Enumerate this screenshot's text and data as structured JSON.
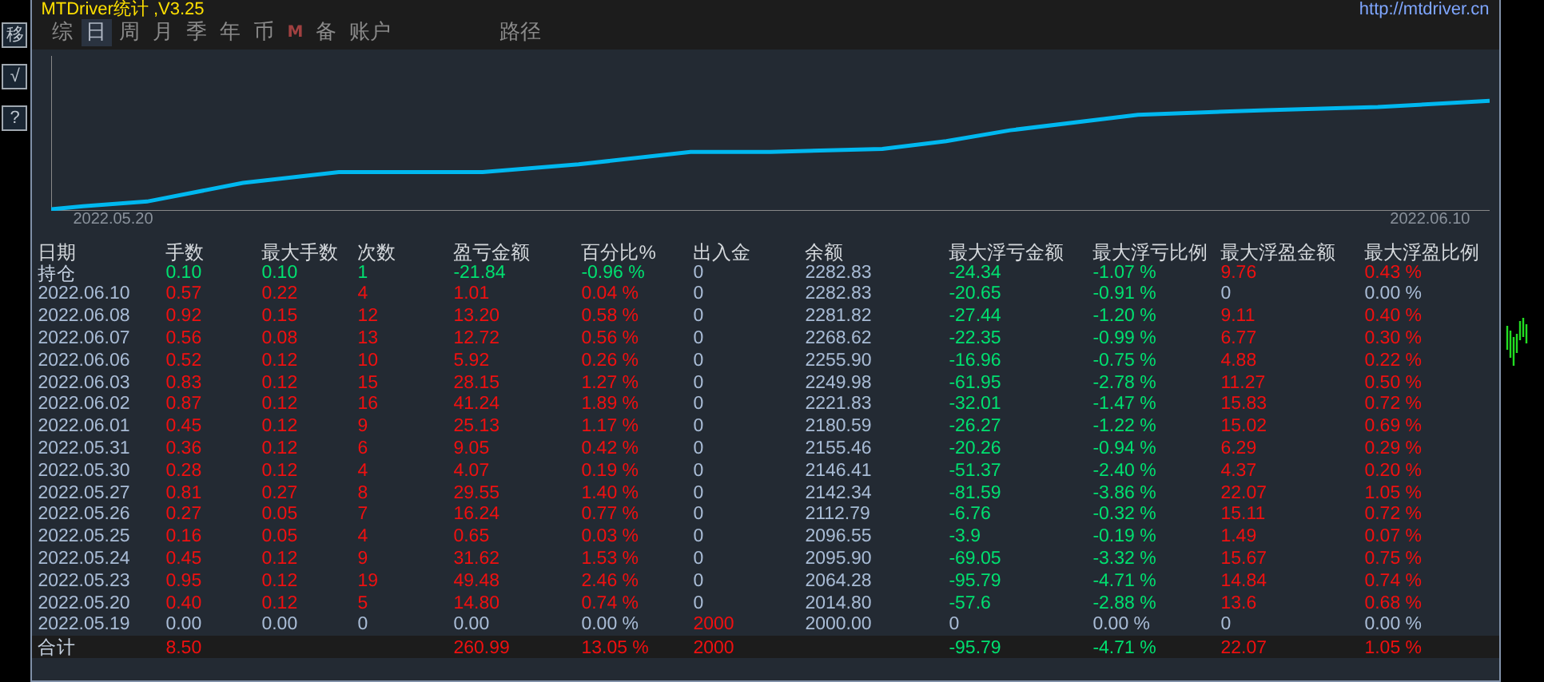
{
  "title": "MTDriver统计 ,V3.25",
  "url": "http://mtdriver.cn",
  "toolbar": [
    "移",
    "√",
    "?"
  ],
  "tabs": [
    {
      "label": "综",
      "selected": false,
      "kind": "text"
    },
    {
      "label": "日",
      "selected": true,
      "kind": "text"
    },
    {
      "label": "周",
      "selected": false,
      "kind": "text"
    },
    {
      "label": "月",
      "selected": false,
      "kind": "text"
    },
    {
      "label": "季",
      "selected": false,
      "kind": "text"
    },
    {
      "label": "年",
      "selected": false,
      "kind": "text"
    },
    {
      "label": "币",
      "selected": false,
      "kind": "text"
    },
    {
      "label": "M",
      "selected": false,
      "kind": "mark"
    },
    {
      "label": "备",
      "selected": false,
      "kind": "text"
    },
    {
      "label": "账户",
      "selected": false,
      "kind": "text"
    },
    {
      "label": "路径",
      "selected": false,
      "kind": "far"
    }
  ],
  "chart": {
    "start_label": "2022.05.20",
    "end_label": "2022.06.10"
  },
  "table": {
    "columns": [
      "日期",
      "手数",
      "最大手数",
      "次数",
      "盈亏金额",
      "百分比%",
      "出入金",
      "余额",
      "最大浮亏金额",
      "最大浮亏比例",
      "最大浮盈金额",
      "最大浮盈比例"
    ],
    "rows": [
      [
        {
          "text": "持仓",
          "color": "#c8d4e4"
        },
        {
          "text": "0.10",
          "color": "#00e070"
        },
        {
          "text": "0.10",
          "color": "#00e070"
        },
        {
          "text": "1",
          "color": "#00e070"
        },
        {
          "text": "-21.84",
          "color": "#00e070"
        },
        {
          "text": "-0.96 %",
          "color": "#00e070"
        },
        {
          "text": "0",
          "color": "#a9bcd6"
        },
        {
          "text": "2282.83",
          "color": "#a9bcd6"
        },
        {
          "text": "-24.34",
          "color": "#00e070"
        },
        {
          "text": "-1.07 %",
          "color": "#00e070"
        },
        {
          "text": "9.76",
          "color": "#f01010"
        },
        {
          "text": "0.43 %",
          "color": "#f01010"
        }
      ],
      [
        {
          "text": "2022.06.10",
          "color": "#a9bcd6"
        },
        {
          "text": "0.57",
          "color": "#f01010"
        },
        {
          "text": "0.22",
          "color": "#f01010"
        },
        {
          "text": "4",
          "color": "#f01010"
        },
        {
          "text": "1.01",
          "color": "#f01010"
        },
        {
          "text": "0.04 %",
          "color": "#f01010"
        },
        {
          "text": "0",
          "color": "#a9bcd6"
        },
        {
          "text": "2282.83",
          "color": "#a9bcd6"
        },
        {
          "text": "-20.65",
          "color": "#00e070"
        },
        {
          "text": "-0.91 %",
          "color": "#00e070"
        },
        {
          "text": "0",
          "color": "#a9bcd6"
        },
        {
          "text": "0.00 %",
          "color": "#a9bcd6"
        }
      ],
      [
        {
          "text": "2022.06.08",
          "color": "#a9bcd6"
        },
        {
          "text": "0.92",
          "color": "#f01010"
        },
        {
          "text": "0.15",
          "color": "#f01010"
        },
        {
          "text": "12",
          "color": "#f01010"
        },
        {
          "text": "13.20",
          "color": "#f01010"
        },
        {
          "text": "0.58 %",
          "color": "#f01010"
        },
        {
          "text": "0",
          "color": "#a9bcd6"
        },
        {
          "text": "2281.82",
          "color": "#a9bcd6"
        },
        {
          "text": "-27.44",
          "color": "#00e070"
        },
        {
          "text": "-1.20 %",
          "color": "#00e070"
        },
        {
          "text": "9.11",
          "color": "#f01010"
        },
        {
          "text": "0.40 %",
          "color": "#f01010"
        }
      ],
      [
        {
          "text": "2022.06.07",
          "color": "#a9bcd6"
        },
        {
          "text": "0.56",
          "color": "#f01010"
        },
        {
          "text": "0.08",
          "color": "#f01010"
        },
        {
          "text": "13",
          "color": "#f01010"
        },
        {
          "text": "12.72",
          "color": "#f01010"
        },
        {
          "text": "0.56 %",
          "color": "#f01010"
        },
        {
          "text": "0",
          "color": "#a9bcd6"
        },
        {
          "text": "2268.62",
          "color": "#a9bcd6"
        },
        {
          "text": "-22.35",
          "color": "#00e070"
        },
        {
          "text": "-0.99 %",
          "color": "#00e070"
        },
        {
          "text": "6.77",
          "color": "#f01010"
        },
        {
          "text": "0.30 %",
          "color": "#f01010"
        }
      ],
      [
        {
          "text": "2022.06.06",
          "color": "#a9bcd6"
        },
        {
          "text": "0.52",
          "color": "#f01010"
        },
        {
          "text": "0.12",
          "color": "#f01010"
        },
        {
          "text": "10",
          "color": "#f01010"
        },
        {
          "text": "5.92",
          "color": "#f01010"
        },
        {
          "text": "0.26 %",
          "color": "#f01010"
        },
        {
          "text": "0",
          "color": "#a9bcd6"
        },
        {
          "text": "2255.90",
          "color": "#a9bcd6"
        },
        {
          "text": "-16.96",
          "color": "#00e070"
        },
        {
          "text": "-0.75 %",
          "color": "#00e070"
        },
        {
          "text": "4.88",
          "color": "#f01010"
        },
        {
          "text": "0.22 %",
          "color": "#f01010"
        }
      ],
      [
        {
          "text": "2022.06.03",
          "color": "#a9bcd6"
        },
        {
          "text": "0.83",
          "color": "#f01010"
        },
        {
          "text": "0.12",
          "color": "#f01010"
        },
        {
          "text": "15",
          "color": "#f01010"
        },
        {
          "text": "28.15",
          "color": "#f01010"
        },
        {
          "text": "1.27 %",
          "color": "#f01010"
        },
        {
          "text": "0",
          "color": "#a9bcd6"
        },
        {
          "text": "2249.98",
          "color": "#a9bcd6"
        },
        {
          "text": "-61.95",
          "color": "#00e070"
        },
        {
          "text": "-2.78 %",
          "color": "#00e070"
        },
        {
          "text": "11.27",
          "color": "#f01010"
        },
        {
          "text": "0.50 %",
          "color": "#f01010"
        }
      ],
      [
        {
          "text": "2022.06.02",
          "color": "#a9bcd6"
        },
        {
          "text": "0.87",
          "color": "#f01010"
        },
        {
          "text": "0.12",
          "color": "#f01010"
        },
        {
          "text": "16",
          "color": "#f01010"
        },
        {
          "text": "41.24",
          "color": "#f01010"
        },
        {
          "text": "1.89 %",
          "color": "#f01010"
        },
        {
          "text": "0",
          "color": "#a9bcd6"
        },
        {
          "text": "2221.83",
          "color": "#a9bcd6"
        },
        {
          "text": "-32.01",
          "color": "#00e070"
        },
        {
          "text": "-1.47 %",
          "color": "#00e070"
        },
        {
          "text": "15.83",
          "color": "#f01010"
        },
        {
          "text": "0.72 %",
          "color": "#f01010"
        }
      ],
      [
        {
          "text": "2022.06.01",
          "color": "#a9bcd6"
        },
        {
          "text": "0.45",
          "color": "#f01010"
        },
        {
          "text": "0.12",
          "color": "#f01010"
        },
        {
          "text": "9",
          "color": "#f01010"
        },
        {
          "text": "25.13",
          "color": "#f01010"
        },
        {
          "text": "1.17 %",
          "color": "#f01010"
        },
        {
          "text": "0",
          "color": "#a9bcd6"
        },
        {
          "text": "2180.59",
          "color": "#a9bcd6"
        },
        {
          "text": "-26.27",
          "color": "#00e070"
        },
        {
          "text": "-1.22 %",
          "color": "#00e070"
        },
        {
          "text": "15.02",
          "color": "#f01010"
        },
        {
          "text": "0.69 %",
          "color": "#f01010"
        }
      ],
      [
        {
          "text": "2022.05.31",
          "color": "#a9bcd6"
        },
        {
          "text": "0.36",
          "color": "#f01010"
        },
        {
          "text": "0.12",
          "color": "#f01010"
        },
        {
          "text": "6",
          "color": "#f01010"
        },
        {
          "text": "9.05",
          "color": "#f01010"
        },
        {
          "text": "0.42 %",
          "color": "#f01010"
        },
        {
          "text": "0",
          "color": "#a9bcd6"
        },
        {
          "text": "2155.46",
          "color": "#a9bcd6"
        },
        {
          "text": "-20.26",
          "color": "#00e070"
        },
        {
          "text": "-0.94 %",
          "color": "#00e070"
        },
        {
          "text": "6.29",
          "color": "#f01010"
        },
        {
          "text": "0.29 %",
          "color": "#f01010"
        }
      ],
      [
        {
          "text": "2022.05.30",
          "color": "#a9bcd6"
        },
        {
          "text": "0.28",
          "color": "#f01010"
        },
        {
          "text": "0.12",
          "color": "#f01010"
        },
        {
          "text": "4",
          "color": "#f01010"
        },
        {
          "text": "4.07",
          "color": "#f01010"
        },
        {
          "text": "0.19 %",
          "color": "#f01010"
        },
        {
          "text": "0",
          "color": "#a9bcd6"
        },
        {
          "text": "2146.41",
          "color": "#a9bcd6"
        },
        {
          "text": "-51.37",
          "color": "#00e070"
        },
        {
          "text": "-2.40 %",
          "color": "#00e070"
        },
        {
          "text": "4.37",
          "color": "#f01010"
        },
        {
          "text": "0.20 %",
          "color": "#f01010"
        }
      ],
      [
        {
          "text": "2022.05.27",
          "color": "#a9bcd6"
        },
        {
          "text": "0.81",
          "color": "#f01010"
        },
        {
          "text": "0.27",
          "color": "#f01010"
        },
        {
          "text": "8",
          "color": "#f01010"
        },
        {
          "text": "29.55",
          "color": "#f01010"
        },
        {
          "text": "1.40 %",
          "color": "#f01010"
        },
        {
          "text": "0",
          "color": "#a9bcd6"
        },
        {
          "text": "2142.34",
          "color": "#a9bcd6"
        },
        {
          "text": "-81.59",
          "color": "#00e070"
        },
        {
          "text": "-3.86 %",
          "color": "#00e070"
        },
        {
          "text": "22.07",
          "color": "#f01010"
        },
        {
          "text": "1.05 %",
          "color": "#f01010"
        }
      ],
      [
        {
          "text": "2022.05.26",
          "color": "#a9bcd6"
        },
        {
          "text": "0.27",
          "color": "#f01010"
        },
        {
          "text": "0.05",
          "color": "#f01010"
        },
        {
          "text": "7",
          "color": "#f01010"
        },
        {
          "text": "16.24",
          "color": "#f01010"
        },
        {
          "text": "0.77 %",
          "color": "#f01010"
        },
        {
          "text": "0",
          "color": "#a9bcd6"
        },
        {
          "text": "2112.79",
          "color": "#a9bcd6"
        },
        {
          "text": "-6.76",
          "color": "#00e070"
        },
        {
          "text": "-0.32 %",
          "color": "#00e070"
        },
        {
          "text": "15.11",
          "color": "#f01010"
        },
        {
          "text": "0.72 %",
          "color": "#f01010"
        }
      ],
      [
        {
          "text": "2022.05.25",
          "color": "#a9bcd6"
        },
        {
          "text": "0.16",
          "color": "#f01010"
        },
        {
          "text": "0.05",
          "color": "#f01010"
        },
        {
          "text": "4",
          "color": "#f01010"
        },
        {
          "text": "0.65",
          "color": "#f01010"
        },
        {
          "text": "0.03 %",
          "color": "#f01010"
        },
        {
          "text": "0",
          "color": "#a9bcd6"
        },
        {
          "text": "2096.55",
          "color": "#a9bcd6"
        },
        {
          "text": "-3.9",
          "color": "#00e070"
        },
        {
          "text": "-0.19 %",
          "color": "#00e070"
        },
        {
          "text": "1.49",
          "color": "#f01010"
        },
        {
          "text": "0.07 %",
          "color": "#f01010"
        }
      ],
      [
        {
          "text": "2022.05.24",
          "color": "#a9bcd6"
        },
        {
          "text": "0.45",
          "color": "#f01010"
        },
        {
          "text": "0.12",
          "color": "#f01010"
        },
        {
          "text": "9",
          "color": "#f01010"
        },
        {
          "text": "31.62",
          "color": "#f01010"
        },
        {
          "text": "1.53 %",
          "color": "#f01010"
        },
        {
          "text": "0",
          "color": "#a9bcd6"
        },
        {
          "text": "2095.90",
          "color": "#a9bcd6"
        },
        {
          "text": "-69.05",
          "color": "#00e070"
        },
        {
          "text": "-3.32 %",
          "color": "#00e070"
        },
        {
          "text": "15.67",
          "color": "#f01010"
        },
        {
          "text": "0.75 %",
          "color": "#f01010"
        }
      ],
      [
        {
          "text": "2022.05.23",
          "color": "#a9bcd6"
        },
        {
          "text": "0.95",
          "color": "#f01010"
        },
        {
          "text": "0.12",
          "color": "#f01010"
        },
        {
          "text": "19",
          "color": "#f01010"
        },
        {
          "text": "49.48",
          "color": "#f01010"
        },
        {
          "text": "2.46 %",
          "color": "#f01010"
        },
        {
          "text": "0",
          "color": "#a9bcd6"
        },
        {
          "text": "2064.28",
          "color": "#a9bcd6"
        },
        {
          "text": "-95.79",
          "color": "#00e070"
        },
        {
          "text": "-4.71 %",
          "color": "#00e070"
        },
        {
          "text": "14.84",
          "color": "#f01010"
        },
        {
          "text": "0.74 %",
          "color": "#f01010"
        }
      ],
      [
        {
          "text": "2022.05.20",
          "color": "#a9bcd6"
        },
        {
          "text": "0.40",
          "color": "#f01010"
        },
        {
          "text": "0.12",
          "color": "#f01010"
        },
        {
          "text": "5",
          "color": "#f01010"
        },
        {
          "text": "14.80",
          "color": "#f01010"
        },
        {
          "text": "0.74 %",
          "color": "#f01010"
        },
        {
          "text": "0",
          "color": "#a9bcd6"
        },
        {
          "text": "2014.80",
          "color": "#a9bcd6"
        },
        {
          "text": "-57.6",
          "color": "#00e070"
        },
        {
          "text": "-2.88 %",
          "color": "#00e070"
        },
        {
          "text": "13.6",
          "color": "#f01010"
        },
        {
          "text": "0.68 %",
          "color": "#f01010"
        }
      ],
      [
        {
          "text": "2022.05.19",
          "color": "#a9bcd6"
        },
        {
          "text": "0.00",
          "color": "#a9bcd6"
        },
        {
          "text": "0.00",
          "color": "#a9bcd6"
        },
        {
          "text": "0",
          "color": "#a9bcd6"
        },
        {
          "text": "0.00",
          "color": "#a9bcd6"
        },
        {
          "text": "0.00 %",
          "color": "#a9bcd6"
        },
        {
          "text": "2000",
          "color": "#f01010"
        },
        {
          "text": "2000.00",
          "color": "#a9bcd6"
        },
        {
          "text": "0",
          "color": "#a9bcd6"
        },
        {
          "text": "0.00 %",
          "color": "#a9bcd6"
        },
        {
          "text": "0",
          "color": "#a9bcd6"
        },
        {
          "text": "0.00 %",
          "color": "#a9bcd6"
        }
      ]
    ],
    "total": {
      "label": {
        "text": "合计",
        "color": "#c8d4e4"
      },
      "lots": {
        "text": "8.50",
        "color": "#f01010"
      },
      "pnl": {
        "text": "260.99",
        "color": "#f01010"
      },
      "percent": {
        "text": "13.05 %",
        "color": "#f01010"
      },
      "cash_flow": {
        "text": "2000",
        "color": "#f01010"
      },
      "max_float_loss": {
        "text": "-95.79",
        "color": "#00e070"
      },
      "max_float_loss_ratio": {
        "text": "-4.71 %",
        "color": "#00e070"
      },
      "max_float_profit": {
        "text": "22.07",
        "color": "#f01010"
      },
      "max_float_profit_ratio": {
        "text": "1.05 %",
        "color": "#f01010"
      }
    }
  }
}
